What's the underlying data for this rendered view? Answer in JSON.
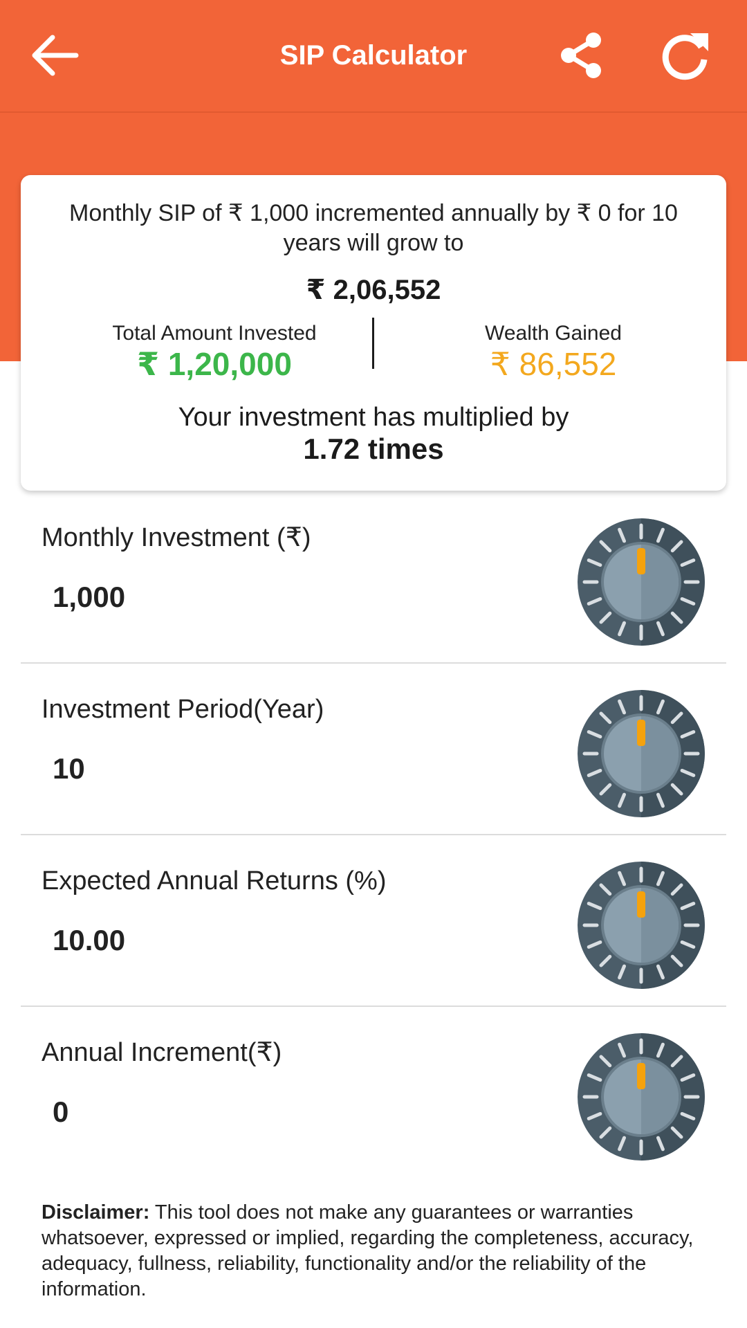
{
  "appbar": {
    "title": "SIP Calculator",
    "back_icon": "arrow-left-icon",
    "share_icon": "share-icon",
    "refresh_icon": "refresh-icon"
  },
  "summary": {
    "line": "Monthly SIP of ₹ 1,000 incremented annually by ₹ 0 for 10 years will grow to",
    "total_value": "₹ 2,06,552",
    "invested_label": "Total Amount Invested",
    "invested_value": "₹ 1,20,000",
    "gained_label": "Wealth Gained",
    "gained_value": "₹ 86,552",
    "multiplied_text": "Your investment has multiplied by",
    "multiplied_value": "1.72 times"
  },
  "inputs": [
    {
      "label": "Monthly Investment (₹)",
      "value": "1,000"
    },
    {
      "label": "Investment Period(Year)",
      "value": "10"
    },
    {
      "label": "Expected Annual Returns (%)",
      "value": "10.00"
    },
    {
      "label": "Annual Increment(₹)",
      "value": "0"
    }
  ],
  "disclaimer": {
    "heading": "Disclaimer:",
    "text": " This tool does not make any guarantees or warranties whatsoever, expressed or implied, regarding the completeness, accuracy, adequacy, fullness, reliability, functionality and/or the reliability of the information."
  },
  "colors": {
    "brand": "#f26438",
    "invested": "#3cb64a",
    "gained": "#f3a81e",
    "knob_dark": "#4b5d69",
    "knob_light": "#8ba0ae",
    "knob_indicator": "#f5a20d"
  }
}
